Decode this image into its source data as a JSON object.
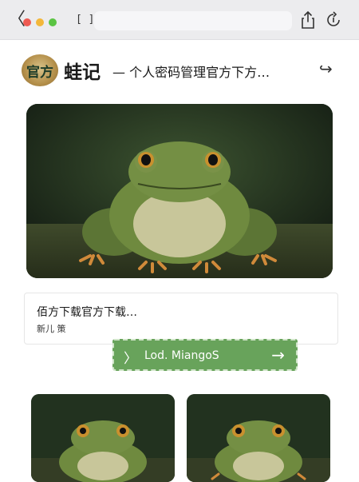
{
  "browser": {
    "back_glyph": "〈",
    "tabs_glyph": "[ ]",
    "url_text": ""
  },
  "header": {
    "logo_text": "官方",
    "title": "蛙记",
    "subtitle": "— 个人密码管理官方下方…",
    "forward_glyph": "↪"
  },
  "card": {
    "title": "佰方下载官方下载…",
    "subtitle": "新儿 策"
  },
  "cta": {
    "left_glyph": "〉",
    "label": "Lod. MiangoS",
    "arrow_glyph": "→"
  },
  "colors": {
    "accent": "#68a35b",
    "frog_body": "#6f8a3f",
    "frog_belly": "#c8c69a",
    "frog_feet": "#d08a3a",
    "eye": "#c9902e"
  },
  "icons": [
    "back-icon",
    "tabs-icon",
    "share-icon",
    "reload-icon",
    "forward-icon",
    "chevron-right-icon",
    "arrow-right-icon"
  ]
}
